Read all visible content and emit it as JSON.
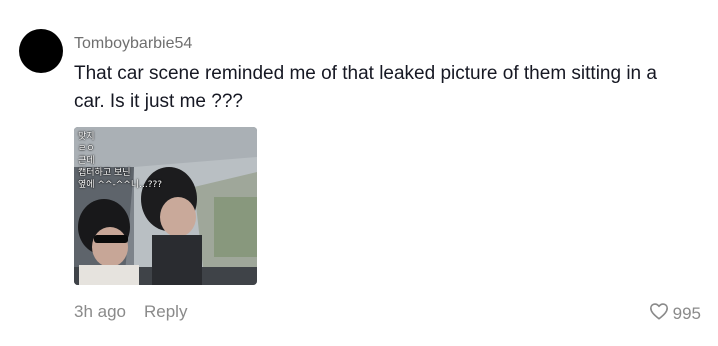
{
  "comment": {
    "username": "Tomboybarbie54",
    "text": "That car scene reminded me of that leaked picture of them sitting in a car. Is it just me ???",
    "image_overlay_lines": [
      "맞지 ",
      "ㄹㅇ",
      "근데",
      "캡터하고 보닌",
      "옆에 ^^-^^니...???"
    ],
    "time": "3h ago",
    "reply_label": "Reply",
    "like_count": "995"
  },
  "icons": {
    "like": "heart-outline-icon"
  },
  "colors": {
    "username": "#6f6f6f",
    "text": "#161823",
    "meta": "#8a8a8a"
  }
}
